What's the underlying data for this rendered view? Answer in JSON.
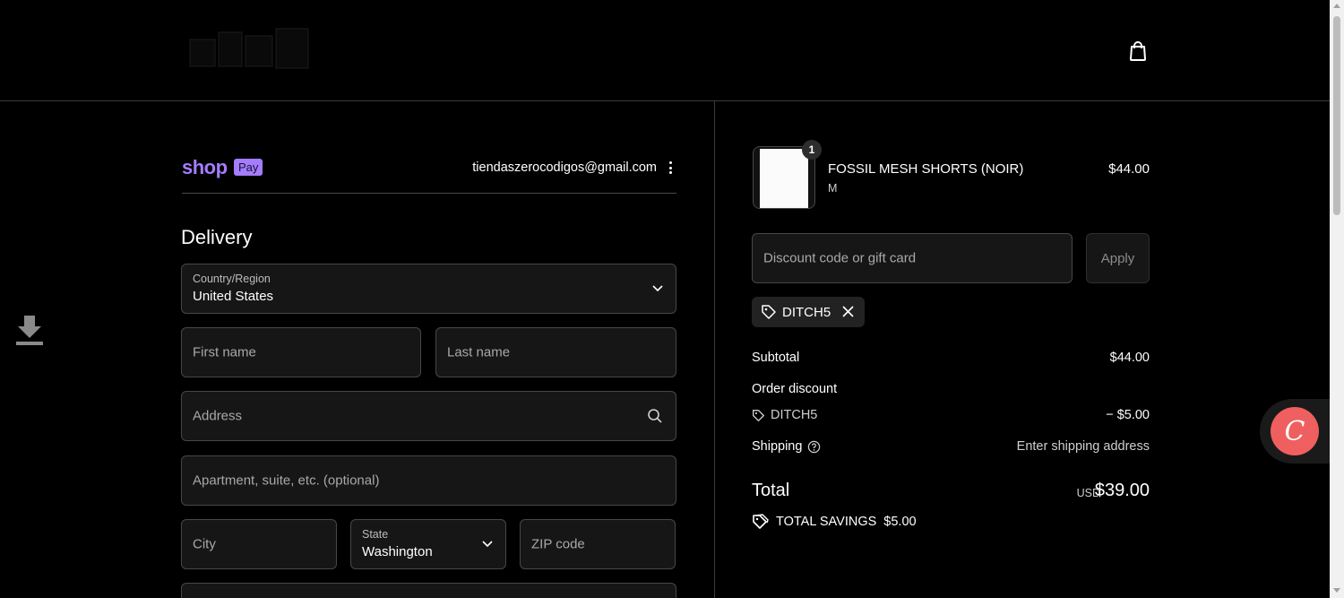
{
  "header": {
    "logo_icon": "brand-logo-icon",
    "cart_icon": "shopping-bag-icon"
  },
  "side": {
    "download_icon": "download-icon"
  },
  "express": {
    "shop_word": "shop",
    "pay_badge": "Pay",
    "email": "tiendaszerocodigos@gmail.com",
    "menu_icon": "kebab-menu-icon"
  },
  "delivery": {
    "heading": "Delivery",
    "country": {
      "label": "Country/Region",
      "value": "United States"
    },
    "first_name": {
      "placeholder": "First name"
    },
    "last_name": {
      "placeholder": "Last name"
    },
    "address": {
      "placeholder": "Address",
      "icon": "search-icon"
    },
    "apartment": {
      "placeholder": "Apartment, suite, etc. (optional)"
    },
    "city": {
      "placeholder": "City"
    },
    "state": {
      "label": "State",
      "value": "Washington"
    },
    "zip": {
      "placeholder": "ZIP code"
    }
  },
  "order": {
    "item": {
      "quantity": "1",
      "title": "FOSSIL MESH SHORTS (NOIR)",
      "variant": "M",
      "price": "$44.00"
    },
    "discount_placeholder": "Discount code or gift card",
    "apply_label": "Apply",
    "applied_code": "DITCH5",
    "subtotal_label": "Subtotal",
    "subtotal_value": "$44.00",
    "order_discount_label": "Order discount",
    "discount_code": "DITCH5",
    "discount_value": "− $5.00",
    "shipping_label": "Shipping",
    "shipping_value": "Enter shipping address",
    "total_label": "Total",
    "currency": "USD",
    "total_value": "$39.00",
    "savings_label": "TOTAL SAVINGS",
    "savings_value": "$5.00"
  },
  "chat": {
    "icon": "chat-widget-icon",
    "glyph": "C"
  },
  "colors": {
    "accent": "#a37dfc",
    "chat": "#f05f5f",
    "background": "#000000"
  }
}
